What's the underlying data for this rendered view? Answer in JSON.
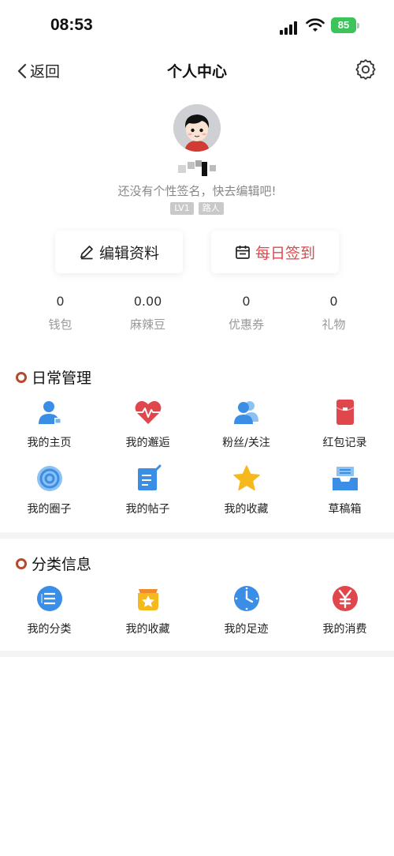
{
  "status_bar": {
    "time": "08:53",
    "battery": "85"
  },
  "nav": {
    "back_label": "返回",
    "title": "个人中心"
  },
  "profile": {
    "signature": "还没有个性签名，快去编辑吧!",
    "level_badge": "LV1",
    "rank_badge": "路人"
  },
  "actions": {
    "edit": "编辑资料",
    "checkin": "每日签到"
  },
  "stats": [
    {
      "value": "0",
      "label": "钱包"
    },
    {
      "value": "0.00",
      "label": "麻辣豆"
    },
    {
      "value": "0",
      "label": "优惠券"
    },
    {
      "value": "0",
      "label": "礼物"
    }
  ],
  "daily": {
    "title": "日常管理",
    "row1": [
      {
        "label": "我的主页",
        "icon": "homepage-icon"
      },
      {
        "label": "我的邂逅",
        "icon": "heartbeat-icon"
      },
      {
        "label": "粉丝/关注",
        "icon": "followers-icon"
      },
      {
        "label": "红包记录",
        "icon": "red-envelope-icon"
      }
    ],
    "row2": [
      {
        "label": "我的圈子",
        "icon": "circle-icon"
      },
      {
        "label": "我的帖子",
        "icon": "post-icon"
      },
      {
        "label": "我的收藏",
        "icon": "star-icon"
      },
      {
        "label": "草稿箱",
        "icon": "draft-box-icon"
      }
    ]
  },
  "category": {
    "title": "分类信息",
    "row1": [
      {
        "label": "我的分类",
        "icon": "list-icon"
      },
      {
        "label": "我的收藏",
        "icon": "favorite-bag-icon"
      },
      {
        "label": "我的足迹",
        "icon": "clock-icon"
      },
      {
        "label": "我的消费",
        "icon": "yuan-icon"
      }
    ]
  },
  "colors": {
    "accent_red": "#e0474c",
    "icon_blue": "#3a8ee6",
    "section_ring": "#b54a2c"
  }
}
